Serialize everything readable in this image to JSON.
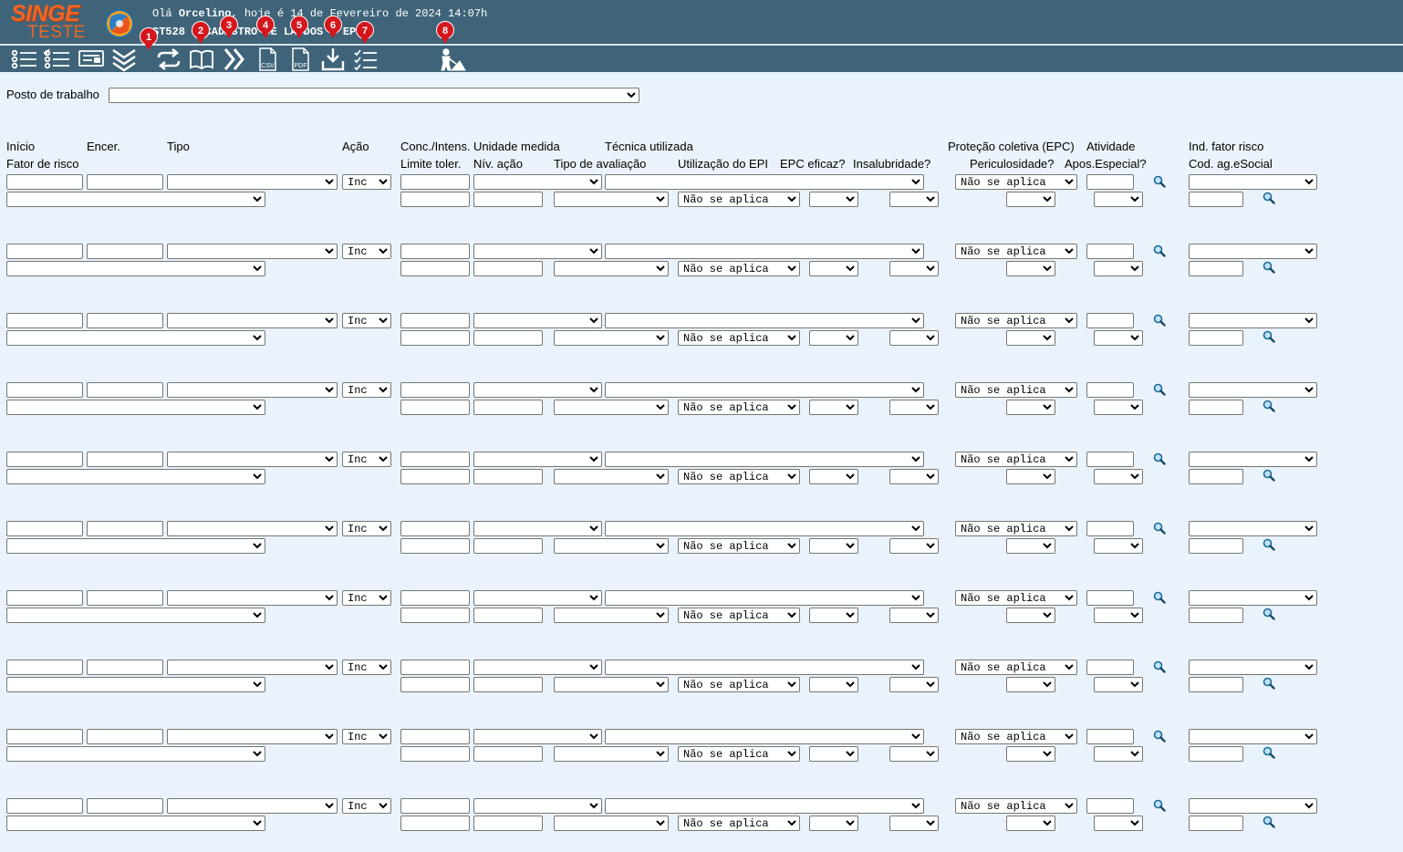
{
  "header": {
    "logo_line1": "SINGE",
    "logo_line2": "TESTE",
    "greeting_prefix": "Olá",
    "user_name": "Orcelino",
    "greeting_suffix": ", hoje é 14 de Fevereiro de 2024 14:07h",
    "program_title": "ST528 - CADASTRO DE LAUDOS - EPI",
    "colors": {
      "bar": "#3f6479",
      "logo": "#f26522",
      "badge": "#d4161d"
    }
  },
  "toolbar": {
    "icons": [
      "list-icon",
      "checklist-icon",
      "card-icon",
      "double-chevron-down-icon",
      "refresh-icon",
      "book-icon",
      "double-chevron-right-icon",
      "csv-file-icon",
      "pdf-file-icon",
      "download-icon",
      "task-list-icon",
      "worker-icon"
    ],
    "badges": [
      "1",
      "2",
      "3",
      "4",
      "5",
      "6",
      "7",
      "8"
    ],
    "csv_label": "CSV",
    "pdf_label": "PDF"
  },
  "form": {
    "posto_label": "Posto de trabalho",
    "posto_value": ""
  },
  "columns": {
    "inicio": "Início",
    "encer": "Encer.",
    "tipo": "Tipo",
    "acao": "Ação",
    "conc": "Conc./Intens.",
    "unidade": "Unidade medida",
    "tecnica": "Técnica utilizada",
    "epc": "Proteção coletiva (EPC)",
    "atividade": "Atividade",
    "ind_fator": "Ind. fator risco",
    "fator": "Fator de risco",
    "limite": "Limite toler.",
    "niv": "Nív. ação",
    "tipo_aval": "Tipo de avaliação",
    "util_epi": "Utilização do EPI",
    "epc_eficaz": "EPC eficaz?",
    "insalub": "Insalubridade?",
    "pericul": "Periculosidade?",
    "apos": "Apos.Especial?",
    "cod_ag": "Cod. ag.eSocial"
  },
  "row_defaults": {
    "acao_value": "Inc",
    "epi_value": "Não se aplica",
    "epc_value": "Não se aplica"
  },
  "rows": [
    {
      "inicio": "",
      "encer": ""
    },
    {
      "inicio": "",
      "encer": ""
    },
    {
      "inicio": "",
      "encer": ""
    },
    {
      "inicio": "",
      "encer": ""
    },
    {
      "inicio": "",
      "encer": ""
    },
    {
      "inicio": "",
      "encer": ""
    },
    {
      "inicio": "",
      "encer": ""
    },
    {
      "inicio": "",
      "encer": ""
    },
    {
      "inicio": "",
      "encer": ""
    },
    {
      "inicio": "",
      "encer": ""
    }
  ]
}
